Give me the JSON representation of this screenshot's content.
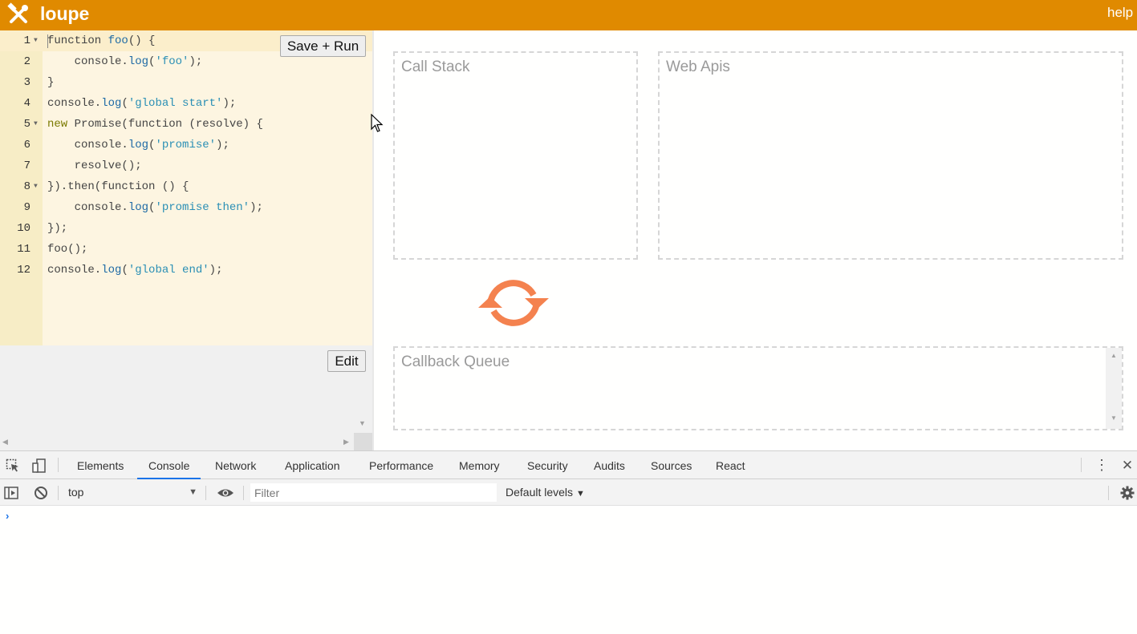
{
  "app": {
    "title": "loupe",
    "help_label": "help",
    "brand_color": "#e08a00"
  },
  "editor": {
    "save_run_label": "Save + Run",
    "lines": [
      {
        "num": "1",
        "foldable": true,
        "tokens": [
          [
            "kw-plain",
            "function "
          ],
          [
            "fn",
            "foo"
          ],
          [
            "plain",
            "() {"
          ]
        ]
      },
      {
        "num": "2",
        "foldable": false,
        "tokens": [
          [
            "plain",
            "    console."
          ],
          [
            "fn",
            "log"
          ],
          [
            "plain",
            "("
          ],
          [
            "str",
            "'foo'"
          ],
          [
            "plain",
            ");"
          ]
        ]
      },
      {
        "num": "3",
        "foldable": false,
        "tokens": [
          [
            "plain",
            "}"
          ]
        ]
      },
      {
        "num": "4",
        "foldable": false,
        "tokens": [
          [
            "plain",
            "console."
          ],
          [
            "fn",
            "log"
          ],
          [
            "plain",
            "("
          ],
          [
            "str",
            "'global start'"
          ],
          [
            "plain",
            ");"
          ]
        ]
      },
      {
        "num": "5",
        "foldable": true,
        "tokens": [
          [
            "kw",
            "new "
          ],
          [
            "plain",
            "Promise("
          ],
          [
            "kw-plain",
            "function "
          ],
          [
            "plain",
            "(resolve) {"
          ]
        ]
      },
      {
        "num": "6",
        "foldable": false,
        "tokens": [
          [
            "plain",
            "    console."
          ],
          [
            "fn",
            "log"
          ],
          [
            "plain",
            "("
          ],
          [
            "str",
            "'promise'"
          ],
          [
            "plain",
            ");"
          ]
        ]
      },
      {
        "num": "7",
        "foldable": false,
        "tokens": [
          [
            "plain",
            "    resolve();"
          ]
        ]
      },
      {
        "num": "8",
        "foldable": true,
        "tokens": [
          [
            "plain",
            "}).then("
          ],
          [
            "kw-plain",
            "function "
          ],
          [
            "plain",
            "() {"
          ]
        ]
      },
      {
        "num": "9",
        "foldable": false,
        "tokens": [
          [
            "plain",
            "    console."
          ],
          [
            "fn",
            "log"
          ],
          [
            "plain",
            "("
          ],
          [
            "str",
            "'promise then'"
          ],
          [
            "plain",
            ");"
          ]
        ]
      },
      {
        "num": "10",
        "foldable": false,
        "tokens": [
          [
            "plain",
            "});"
          ]
        ]
      },
      {
        "num": "11",
        "foldable": false,
        "tokens": [
          [
            "plain",
            "foo();"
          ]
        ]
      },
      {
        "num": "12",
        "foldable": false,
        "tokens": [
          [
            "plain",
            "console."
          ],
          [
            "fn",
            "log"
          ],
          [
            "plain",
            "("
          ],
          [
            "str",
            "'global end'"
          ],
          [
            "plain",
            ");"
          ]
        ]
      }
    ]
  },
  "output": {
    "edit_label": "Edit"
  },
  "loupe": {
    "call_stack_title": "Call Stack",
    "web_apis_title": "Web Apis",
    "callback_queue_title": "Callback Queue",
    "event_loop_color": "#f4824f"
  },
  "devtools": {
    "tabs": [
      {
        "label": "Elements",
        "active": false
      },
      {
        "label": "Console",
        "active": true
      },
      {
        "label": "Network",
        "active": false
      },
      {
        "label": "Application",
        "active": false
      },
      {
        "label": "Performance",
        "active": false
      },
      {
        "label": "Memory",
        "active": false
      },
      {
        "label": "Security",
        "active": false
      },
      {
        "label": "Audits",
        "active": false
      },
      {
        "label": "Sources",
        "active": false
      },
      {
        "label": "React",
        "active": false
      }
    ],
    "context": "top",
    "filter_placeholder": "Filter",
    "levels_label": "Default levels",
    "accent_color": "#1a73e8"
  }
}
